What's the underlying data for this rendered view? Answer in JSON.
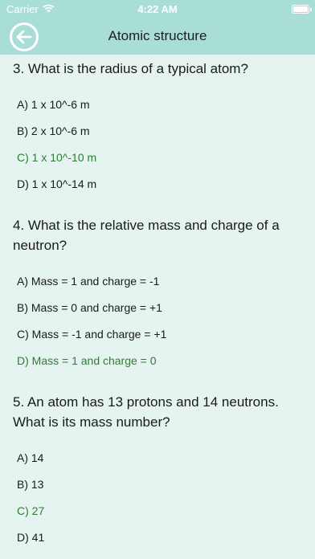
{
  "status_bar": {
    "carrier": "Carrier",
    "time": "4:22 AM"
  },
  "nav": {
    "title": "Atomic structure",
    "back_icon": "back-arrow-icon"
  },
  "colors": {
    "header_bg": "#a9ded6",
    "page_bg": "#e6f4f1",
    "correct_answer": "#2e7d32"
  },
  "questions": [
    {
      "text": "3. What is the radius of a typical atom?",
      "options": [
        {
          "label": "A) 1 x 10^-6 m",
          "correct": false
        },
        {
          "label": "B) 2 x 10^-6 m",
          "correct": false
        },
        {
          "label": "C) 1 x 10^-10 m",
          "correct": true
        },
        {
          "label": "D) 1 x 10^-14 m",
          "correct": false
        }
      ]
    },
    {
      "text": "4. What is the relative mass and charge of a neutron?",
      "options": [
        {
          "label": "A) Mass = 1 and charge = -1",
          "correct": false
        },
        {
          "label": "B) Mass = 0 and charge = +1",
          "correct": false
        },
        {
          "label": "C) Mass = -1 and charge = +1",
          "correct": false
        },
        {
          "label": "D) Mass = 1 and charge = 0",
          "correct": true
        }
      ]
    },
    {
      "text": "5. An atom has 13 protons and 14 neutrons. What is its mass number?",
      "options": [
        {
          "label": "A) 14",
          "correct": false
        },
        {
          "label": "B) 13",
          "correct": false
        },
        {
          "label": "C) 27",
          "correct": true
        },
        {
          "label": "D) 41",
          "correct": false
        }
      ]
    }
  ]
}
